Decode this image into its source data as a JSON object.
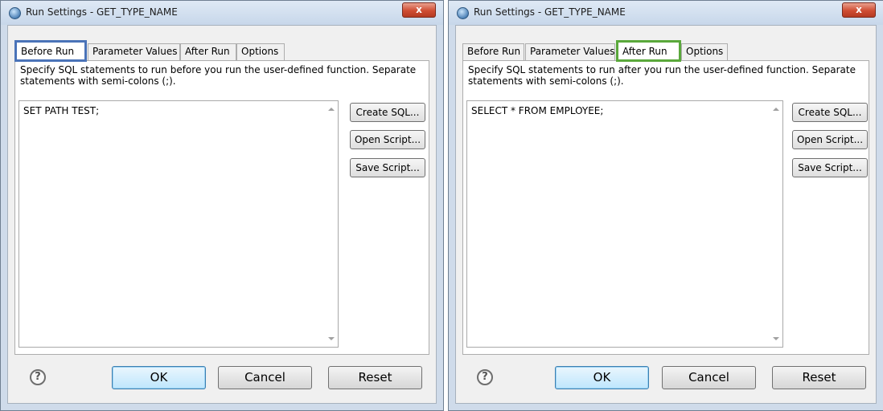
{
  "dialogs": [
    {
      "title": "Run Settings - GET_TYPE_NAME",
      "close_label": "x",
      "tabs": [
        "Before Run",
        "Parameter Values",
        "After Run",
        "Options"
      ],
      "active_tab": "Before Run",
      "highlight_color": "#4a73b8",
      "description": "Specify SQL statements to run before you run the user-defined function. Separate statements with semi-colons (;).",
      "sql_text": "SET PATH TEST;",
      "side_buttons": [
        "Create SQL...",
        "Open Script...",
        "Save Script..."
      ],
      "help_icon": "?",
      "buttons": {
        "ok": "OK",
        "cancel": "Cancel",
        "reset": "Reset"
      }
    },
    {
      "title": "Run Settings - GET_TYPE_NAME",
      "close_label": "x",
      "tabs": [
        "Before Run",
        "Parameter Values",
        "After Run",
        "Options"
      ],
      "active_tab": "After Run",
      "highlight_color": "#5aa83b",
      "description": "Specify SQL statements to run after you run the user-defined function. Separate statements with semi-colons (;).",
      "sql_text": "SELECT * FROM EMPLOYEE;",
      "side_buttons": [
        "Create SQL...",
        "Open Script...",
        "Save Script..."
      ],
      "help_icon": "?",
      "buttons": {
        "ok": "OK",
        "cancel": "Cancel",
        "reset": "Reset"
      }
    }
  ]
}
